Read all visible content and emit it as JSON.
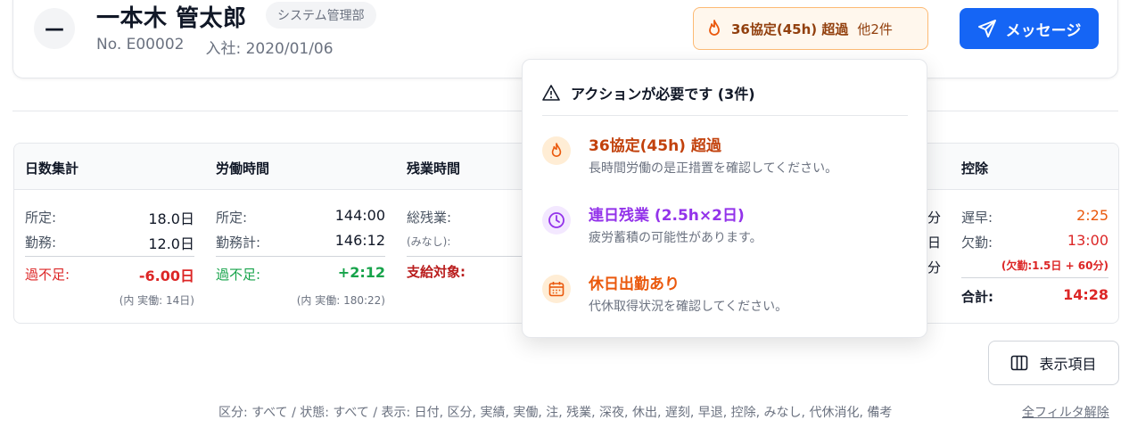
{
  "header": {
    "name": "一本木 管太郎",
    "department": "システム管理部",
    "employee_no": "No. E00002",
    "joined": "入社: 2020/01/06",
    "alert_chip": {
      "label": "36協定(45h) 超過",
      "more": "他2件"
    },
    "message_button": "メッセージ"
  },
  "summary": {
    "columns": [
      {
        "title": "日数集計",
        "rows": [
          {
            "label": "所定:",
            "value": "18.0日"
          },
          {
            "label": "勤務:",
            "value": "12.0日"
          }
        ],
        "total": {
          "label": "過不足:",
          "value": "-6.00日"
        },
        "note": "(内 実働: 14日)"
      },
      {
        "title": "労働時間",
        "rows": [
          {
            "label": "所定:",
            "value": "144:00"
          },
          {
            "label": "勤務計:",
            "value": "146:12"
          }
        ],
        "total": {
          "label": "過不足:",
          "value": "+2:12"
        },
        "note": "(内 実働: 180:22)"
      },
      {
        "title": "残業時間",
        "rows": [
          {
            "label": "総残業:",
            "value": ""
          },
          {
            "label": "(みなし):",
            "value": ""
          }
        ],
        "total": {
          "label": "支給対象:",
          "value": ""
        }
      },
      {
        "title": "",
        "partial": [
          "分",
          "日",
          "分"
        ]
      },
      {
        "title": "控除",
        "rows": [
          {
            "label": "遅早:",
            "value": "2:25"
          },
          {
            "label": "欠勤:",
            "value": "13:00"
          }
        ],
        "note": "(欠勤:1.5日 + 60分)",
        "total": {
          "label": "合計:",
          "value": "14:28"
        }
      }
    ]
  },
  "popover": {
    "title": "アクションが必要です (3件)",
    "items": [
      {
        "icon": "flame-icon",
        "title": "36協定(45h) 超過",
        "desc": "長時間労働の是正措置を確認してください。",
        "color": "#c2410c",
        "bg": "#ffedd5"
      },
      {
        "icon": "clock-icon",
        "title": "連日残業 (2.5h×2日)",
        "desc": "疲労蓄積の可能性があります。",
        "color": "#9333ea",
        "bg": "#f3e8ff"
      },
      {
        "icon": "calendar-icon",
        "title": "休日出勤あり",
        "desc": "代休取得状況を確認してください。",
        "color": "#ea580c",
        "bg": "#ffedd5"
      }
    ]
  },
  "display_button": "表示項目",
  "filter_text": "区分: すべて / 状態: すべて / 表示: 日付, 区分, 実績, 実働, 注, 残業, 深夜, 休出, 遅刻, 早退, 控除, みなし, 代休消化, 備考",
  "filter_clear": "全フィルタ解除"
}
